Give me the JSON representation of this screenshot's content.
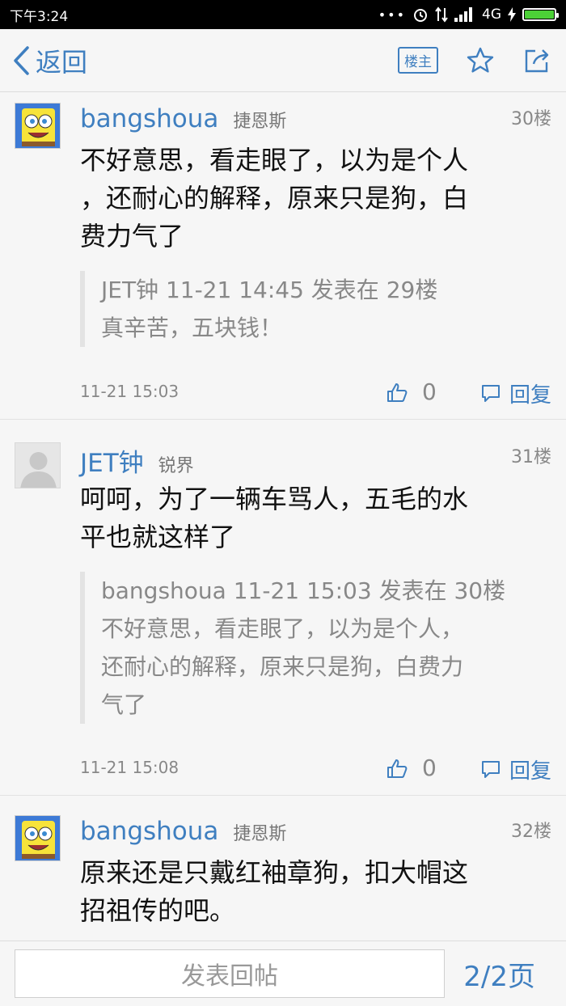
{
  "status_bar": {
    "time": "下午3:24",
    "network": "4G",
    "dots": "•••"
  },
  "header": {
    "back_label": "返回",
    "louzhu_label": "楼主"
  },
  "posts": [
    {
      "username": "bangshoua",
      "device": "捷恩斯",
      "floor": "30楼",
      "content_lines": [
        "不好意思，看走眼了，以为是个人",
        "，还耐心的解释，原来只是狗，白",
        "费力气了"
      ],
      "quote_lines": [
        "JET钟 11-21 14:45 发表在 29楼",
        "真辛苦，五块钱！"
      ],
      "time": "11-21 15:03",
      "likes": "0",
      "reply_label": "回复"
    },
    {
      "username": "JET钟",
      "device": "锐界",
      "floor": "31楼",
      "content_lines": [
        "呵呵，为了一辆车骂人，五毛的水",
        "平也就这样了"
      ],
      "quote_lines": [
        "bangshoua 11-21 15:03 发表在 30楼",
        "不好意思，看走眼了，以为是个人，",
        "还耐心的解释，原来只是狗，白费力",
        "气了"
      ],
      "time": "11-21 15:08",
      "likes": "0",
      "reply_label": "回复"
    },
    {
      "username": "bangshoua",
      "device": "捷恩斯",
      "floor": "32楼",
      "content_lines": [
        "原来还是只戴红袖章狗，扣大帽这",
        "招祖传的吧。"
      ]
    }
  ],
  "bottom_bar": {
    "reply_placeholder": "发表回帖",
    "page_indicator": "2/2页"
  },
  "colors": {
    "accent": "#3f7fc0",
    "battery": "#4cd137"
  }
}
